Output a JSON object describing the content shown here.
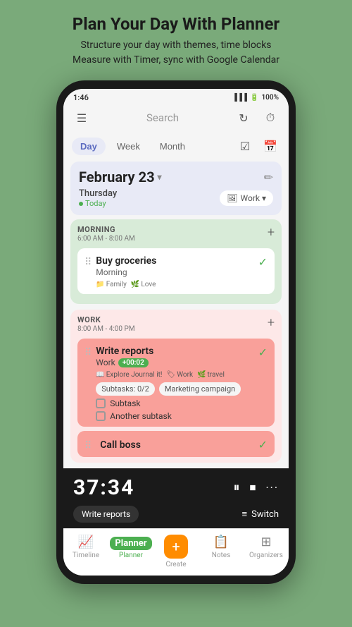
{
  "header": {
    "title": "Plan Your Day With Planner",
    "subtitle": "Structure your day with themes, time blocks\nMeasure with Timer, sync with Google Calendar"
  },
  "statusBar": {
    "time": "1:46",
    "battery": "100%",
    "icons": "status-icons"
  },
  "topBar": {
    "search_placeholder": "Search",
    "hamburger": "☰",
    "refresh_icon": "↻",
    "timer_icon": "⏱"
  },
  "tabs": {
    "items": [
      "Day",
      "Week",
      "Month"
    ],
    "active": "Day"
  },
  "dateHeader": {
    "date": "February 23",
    "chevron": "▾",
    "day": "Thursday",
    "today": "Today",
    "work_tag": "Work ▾",
    "edit": "✏"
  },
  "morningSection": {
    "title": "MORNING",
    "time": "6:00 AM - 8:00 AM",
    "add": "+",
    "task": {
      "title": "Buy groceries",
      "subtitle": "Morning",
      "tags": [
        "Family",
        "Love"
      ],
      "checked": true
    }
  },
  "workSection": {
    "title": "WORK",
    "time": "8:00 AM - 4:00 PM",
    "add": "+",
    "tasks": [
      {
        "title": "Write reports",
        "subtitle": "Work",
        "timer": "+00:02",
        "tags": [
          "Explore Journal it!",
          "Work",
          "travel"
        ],
        "subtask_label": "Subtasks: 0/2",
        "marketing": "Marketing campaign",
        "subtasks": [
          "Subtask",
          "Another subtask"
        ],
        "checked": true
      },
      {
        "title": "Call boss",
        "checked": true
      }
    ]
  },
  "timer": {
    "display": "37:34",
    "label": "Write reports",
    "switch": "Switch",
    "controls": {
      "pause": "⏸",
      "stop": "⏹",
      "more": "···"
    }
  },
  "bottomNav": {
    "items": [
      {
        "label": "Timeline",
        "icon": "📈",
        "active": false
      },
      {
        "label": "Planner",
        "icon": "23",
        "active": true,
        "badge": true
      },
      {
        "label": "Create",
        "icon": "+",
        "active": false,
        "create": true
      },
      {
        "label": "Notes",
        "icon": "📋",
        "active": false
      },
      {
        "label": "Organizers",
        "icon": "⊞",
        "active": false
      }
    ]
  }
}
